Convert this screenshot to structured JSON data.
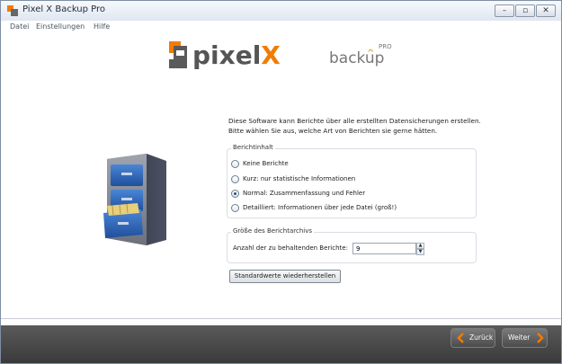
{
  "window": {
    "title": "Pixel X Backup Pro"
  },
  "menu": {
    "items": [
      "Datei",
      "Einstellungen",
      "Hilfe"
    ]
  },
  "logo": {
    "brand": "pixelX",
    "product": "backup",
    "edition": "PRO"
  },
  "intro": {
    "line1": "Diese Software kann Berichte über alle erstellten Datensicherungen erstellen.",
    "line2": "Bitte wählen Sie aus, welche Art von Berichten sie gerne hätten."
  },
  "report_content": {
    "legend": "Berichtinhalt",
    "options": [
      {
        "label": "Keine Berichte",
        "checked": false
      },
      {
        "label": "Kurz: nur statistische Informationen",
        "checked": false
      },
      {
        "label": "Normal: Zusammenfassung und Fehler",
        "checked": true
      },
      {
        "label": "Detailliert: Informationen über jede Datei (groß!)",
        "checked": false
      }
    ]
  },
  "archive": {
    "legend": "Größe des Berichtarchivs",
    "label": "Anzahl der zu behaltenden Berichte:",
    "value": "9"
  },
  "buttons": {
    "reset": "Standardwerte wiederherstellen",
    "back": "Zurück",
    "next": "Weiter"
  },
  "colors": {
    "accent": "#f07c00",
    "logo_dark": "#555555",
    "footer": "#444444"
  }
}
